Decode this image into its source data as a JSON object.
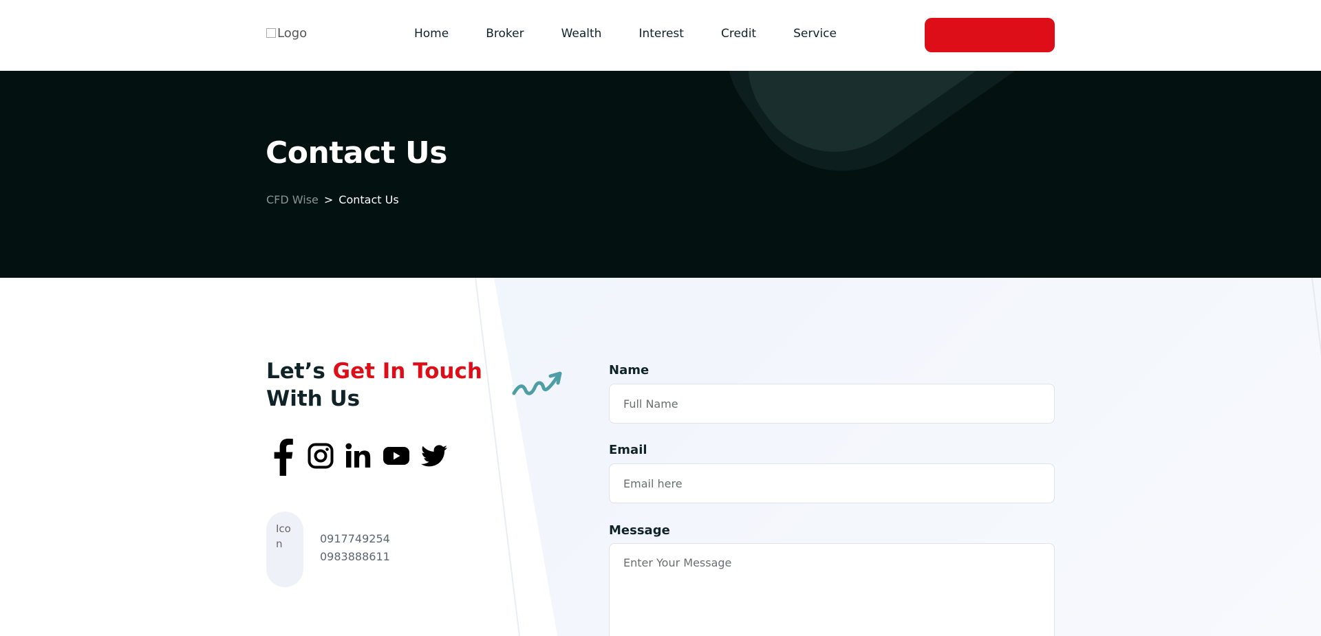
{
  "header": {
    "logo_alt": "Logo",
    "nav": [
      "Home",
      "Broker",
      "Wealth",
      "Interest",
      "Credit",
      "Service"
    ],
    "cta_label": ""
  },
  "hero": {
    "title": "Contact Us",
    "breadcrumb": {
      "home": "CFD Wise",
      "separator": ">",
      "current": "Contact Us"
    }
  },
  "contact": {
    "heading_part1": "Let’s ",
    "heading_highlight": "Get In Touch",
    "heading_part2": "With Us",
    "socials": [
      "facebook-icon",
      "instagram-icon",
      "linkedin-icon",
      "youtube-icon",
      "twitter-icon"
    ],
    "icon_alt": "Icon",
    "phones": [
      "0917749254",
      "0983888611"
    ]
  },
  "form": {
    "name_label": "Name",
    "name_placeholder": "Full Name",
    "email_label": "Email",
    "email_placeholder": "Email here",
    "message_label": "Message",
    "message_placeholder": "Enter Your Message"
  },
  "colors": {
    "accent": "#dd0e18",
    "hero_bg": "#031211",
    "text_dark": "#0f2328",
    "squiggle": "#4e9ea6"
  }
}
